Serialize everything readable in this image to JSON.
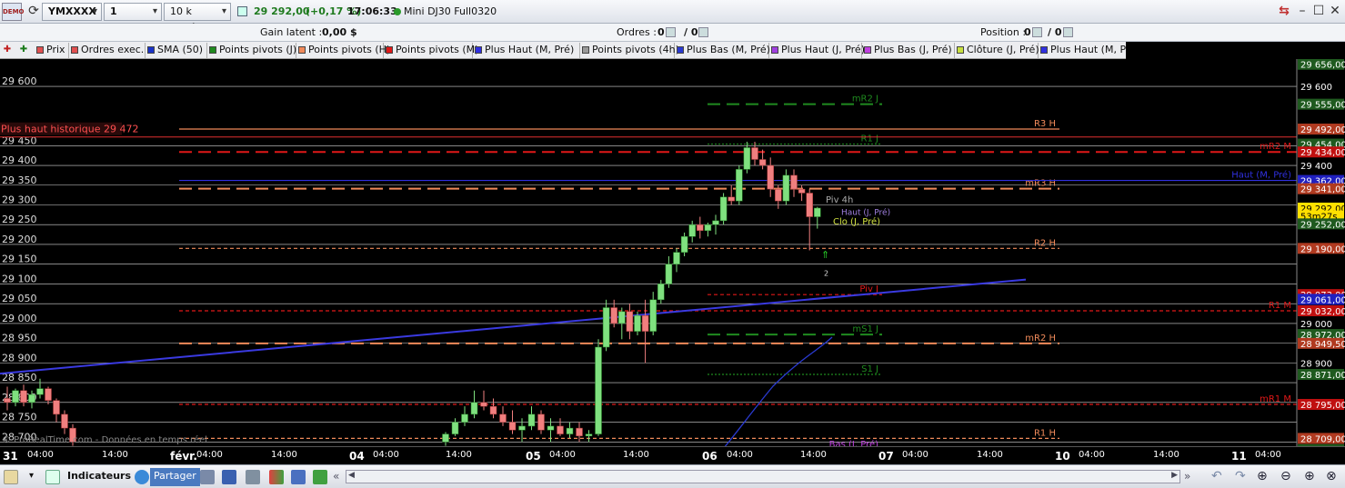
{
  "toolbar": {
    "demo": "DEMO",
    "symbol": "YMXXXX",
    "timeframe": "1 heure",
    "units": "10 k unités",
    "price": "29 292,00",
    "change": "(+0,17 %)",
    "time": "17:06:33",
    "instrument": "Mini DJ30 Full0320",
    "accent": "#2a8a2a"
  },
  "infobar": {
    "gain_label": "Gain latent :",
    "gain_value": "0,00 $",
    "orders_label": "Ordres :",
    "orders_a": "0",
    "orders_b": "/ 0",
    "position_label": "Position :",
    "position_a": "0",
    "position_b": "/ 0"
  },
  "legend": [
    {
      "label": "Prix",
      "color": "#e05050"
    },
    {
      "label": "Ordres exec.",
      "color": "#e05050"
    },
    {
      "label": "SMA (50)",
      "color": "#1a33c8"
    },
    {
      "label": "Points pivots (J)",
      "color": "#1f8a1f"
    },
    {
      "label": "Points pivots (H)",
      "color": "#f08a5a"
    },
    {
      "label": "Points pivots (M)",
      "color": "#e01818"
    },
    {
      "label": "Plus Haut (M, Pré)",
      "color": "#3030e0"
    },
    {
      "label": "Points pivots (4h)",
      "color": "#9a9a9a"
    },
    {
      "label": "Plus Bas (M, Pré)",
      "color": "#2a3ad0"
    },
    {
      "label": "Plus Haut (J, Pré)",
      "color": "#a040e0"
    },
    {
      "label": "Plus Bas (J, Pré)",
      "color": "#c040e0"
    },
    {
      "label": "Clôture (J, Pré)",
      "color": "#c8e040"
    },
    {
      "label": "Plus Haut (M, Pré)",
      "color": "#3030e0"
    }
  ],
  "chart_data": {
    "type": "candlestick",
    "ylim": [
      28680,
      29660
    ],
    "y_ticks": [
      "29 600",
      "29 450",
      "29 400",
      "29 350",
      "29 300",
      "29 250",
      "29 200",
      "29 150",
      "29 100",
      "29 050",
      "29 000",
      "28 950",
      "28 900",
      "28 850",
      "28 800",
      "28 750",
      "28 700"
    ],
    "x_ticks": [
      "31",
      "04:00",
      "14:00",
      "févr.",
      "04:00",
      "14:00",
      "04",
      "04:00",
      "14:00",
      "05",
      "04:00",
      "14:00",
      "06",
      "04:00",
      "14:00",
      "07",
      "04:00",
      "14:00",
      "10",
      "04:00",
      "14:00",
      "11",
      "04:00"
    ],
    "candles": [
      [
        28810,
        28840,
        28780,
        28800
      ],
      [
        28800,
        28835,
        28790,
        28830
      ],
      [
        28830,
        28845,
        28790,
        28800
      ],
      [
        28800,
        28830,
        28785,
        28820
      ],
      [
        28820,
        28860,
        28810,
        28835
      ],
      [
        28835,
        28840,
        28795,
        28805
      ],
      [
        28805,
        28810,
        28750,
        28770
      ],
      [
        28770,
        28780,
        28720,
        28735
      ],
      [
        28735,
        28745,
        28690,
        28700
      ],
      [
        28700,
        28725,
        28690,
        28720
      ],
      [
        28720,
        28760,
        28715,
        28750
      ],
      [
        28750,
        28790,
        28740,
        28770
      ],
      [
        28770,
        28830,
        28760,
        28800
      ],
      [
        28800,
        28830,
        28780,
        28790
      ],
      [
        28790,
        28810,
        28760,
        28770
      ],
      [
        28770,
        28790,
        28740,
        28750
      ],
      [
        28750,
        28780,
        28720,
        28730
      ],
      [
        28730,
        28760,
        28700,
        28740
      ],
      [
        28740,
        28790,
        28730,
        28770
      ],
      [
        28770,
        28780,
        28720,
        28730
      ],
      [
        28730,
        28760,
        28700,
        28740
      ],
      [
        28740,
        28760,
        28715,
        28720
      ],
      [
        28720,
        28750,
        28710,
        28735
      ],
      [
        28735,
        28750,
        28700,
        28715
      ],
      [
        28715,
        28730,
        28700,
        28720
      ],
      [
        28720,
        28960,
        28715,
        28940
      ],
      [
        28940,
        29060,
        28930,
        29040
      ],
      [
        29040,
        29060,
        28990,
        29000
      ],
      [
        29000,
        29040,
        28960,
        29030
      ],
      [
        29030,
        29050,
        28960,
        28980
      ],
      [
        28980,
        29030,
        28970,
        29020
      ],
      [
        29020,
        29060,
        28900,
        28980
      ],
      [
        28980,
        29080,
        28970,
        29060
      ],
      [
        29060,
        29110,
        29050,
        29100
      ],
      [
        29100,
        29170,
        29090,
        29150
      ],
      [
        29150,
        29190,
        29130,
        29180
      ],
      [
        29180,
        29230,
        29170,
        29220
      ],
      [
        29220,
        29260,
        29205,
        29250
      ],
      [
        29250,
        29270,
        29215,
        29235
      ],
      [
        29235,
        29255,
        29220,
        29250
      ],
      [
        29250,
        29275,
        29225,
        29260
      ],
      [
        29260,
        29330,
        29250,
        29320
      ],
      [
        29320,
        29350,
        29300,
        29310
      ],
      [
        29310,
        29400,
        29300,
        29390
      ],
      [
        29390,
        29460,
        29380,
        29445
      ],
      [
        29445,
        29460,
        29400,
        29415
      ],
      [
        29415,
        29440,
        29390,
        29400
      ],
      [
        29400,
        29420,
        29320,
        29340
      ],
      [
        29340,
        29350,
        29290,
        29310
      ],
      [
        29310,
        29390,
        29300,
        29375
      ],
      [
        29375,
        29390,
        29320,
        29340
      ],
      [
        29340,
        29350,
        29310,
        29330
      ],
      [
        29330,
        29340,
        29185,
        29270
      ],
      [
        29270,
        29295,
        29240,
        29292
      ]
    ],
    "sma": [
      [
        28720,
        18
      ],
      [
        28800,
        20
      ],
      [
        28900,
        21
      ],
      [
        29000,
        22
      ],
      [
        29040,
        24
      ]
    ],
    "trendline": [
      [
        28850,
        0
      ],
      [
        29065,
        1128
      ]
    ],
    "levels": [
      {
        "label": "mR2 J",
        "value": 29555,
        "color": "#1f8a1f",
        "style": "longdash"
      },
      {
        "label": "R3 H",
        "value": 29492,
        "color": "#f08a5a",
        "style": "solid"
      },
      {
        "label": "R1 J",
        "value": 29454,
        "color": "#1f8a1f",
        "style": "dot"
      },
      {
        "label": "mR2 M",
        "value": 29434,
        "color": "#e01818",
        "style": "longdash"
      },
      {
        "label": "mR3 H",
        "value": 29341,
        "color": "#f08a5a",
        "style": "longdash"
      },
      {
        "label": "Haut (M, Pré)",
        "value": 29362,
        "color": "#3030e0",
        "style": "solid"
      },
      {
        "label": "R2 H",
        "value": 29190,
        "color": "#f08a5a",
        "style": "dash"
      },
      {
        "label": "Piv J",
        "value": 29073,
        "color": "#e01818",
        "style": "dash"
      },
      {
        "label": "R1 M",
        "value": 29032,
        "color": "#e01818",
        "style": "dash"
      },
      {
        "label": "mS1 J",
        "value": 28972,
        "color": "#1f8a1f",
        "style": "longdash"
      },
      {
        "label": "mR2 H",
        "value": 28949.5,
        "color": "#f08a5a",
        "style": "longdash"
      },
      {
        "label": "S1 J",
        "value": 28871,
        "color": "#1f8a1f",
        "style": "dot"
      },
      {
        "label": "mR1 M",
        "value": 28795,
        "color": "#e01818",
        "style": "dash"
      },
      {
        "label": "R1 H",
        "value": 28709,
        "color": "#f08a5a",
        "style": "dash"
      },
      {
        "label": "Bas (J, Pré)",
        "value": 28680,
        "color": "#c040e0",
        "style": "solid"
      }
    ],
    "right_labels": [
      {
        "text": "29 656,00",
        "value": 29656,
        "bg": "#1f5a1f",
        "fg": "#fff"
      },
      {
        "text": "29 600",
        "value": 29600,
        "bg": "#000",
        "fg": "#fff"
      },
      {
        "text": "29 555,00",
        "value": 29555,
        "bg": "#1f5a1f",
        "fg": "#fff"
      },
      {
        "text": "29 492,00",
        "value": 29492,
        "bg": "#b03a20",
        "fg": "#fff"
      },
      {
        "text": "29 454,00",
        "value": 29454,
        "bg": "#1f5a1f",
        "fg": "#fff"
      },
      {
        "text": "29 434,00",
        "value": 29434,
        "bg": "#c01010",
        "fg": "#fff"
      },
      {
        "text": "29 400",
        "value": 29400,
        "bg": "#000",
        "fg": "#fff"
      },
      {
        "text": "29 362,00",
        "value": 29362,
        "bg": "#2020c0",
        "fg": "#fff"
      },
      {
        "text": "29 341,00",
        "value": 29341,
        "bg": "#b03a20",
        "fg": "#fff"
      },
      {
        "text": "29 292,00",
        "value": 29292,
        "bg": "#ffe000",
        "fg": "#000"
      },
      {
        "text": "53m27s",
        "value": 29272,
        "bg": "#ffe000",
        "fg": "#000"
      },
      {
        "text": "29 252,00",
        "value": 29252,
        "bg": "#1f5a1f",
        "fg": "#fff"
      },
      {
        "text": "29 190,00",
        "value": 29190,
        "bg": "#b03a20",
        "fg": "#fff"
      },
      {
        "text": "29 073,00",
        "value": 29073,
        "bg": "#c01010",
        "fg": "#fff"
      },
      {
        "text": "29 061,00",
        "value": 29061,
        "bg": "#2020c0",
        "fg": "#fff"
      },
      {
        "text": "29 032,00",
        "value": 29032,
        "bg": "#c01010",
        "fg": "#fff"
      },
      {
        "text": "29 000",
        "value": 29000,
        "bg": "#000",
        "fg": "#fff"
      },
      {
        "text": "28 972,00",
        "value": 28972,
        "bg": "#1f5a1f",
        "fg": "#fff"
      },
      {
        "text": "28 949,50",
        "value": 28949.5,
        "bg": "#b03a20",
        "fg": "#fff"
      },
      {
        "text": "28 900",
        "value": 28900,
        "bg": "#000",
        "fg": "#fff"
      },
      {
        "text": "28 871,00",
        "value": 28871,
        "bg": "#1f5a1f",
        "fg": "#fff"
      },
      {
        "text": "28 795,00",
        "value": 28795,
        "bg": "#c01010",
        "fg": "#fff"
      },
      {
        "text": "28 709,00",
        "value": 28709,
        "bg": "#b03a20",
        "fg": "#fff"
      },
      {
        "text": "28 680,50",
        "value": 28680.5,
        "bg": "#1f5a1f",
        "fg": "#fff"
      }
    ],
    "annotations": {
      "historic_high": "Plus haut historique 29 472",
      "historic_high_value": 29472,
      "piv4h": "Piv 4h",
      "clo": "Clo (J, Pré)",
      "haut_j": "Haut (J, Pré)",
      "order_count": "2",
      "watermark": "© ProRealTime.com - Données en temps réel"
    }
  },
  "bottombar": {
    "indicators": "Indicateurs",
    "share": "Partager"
  }
}
